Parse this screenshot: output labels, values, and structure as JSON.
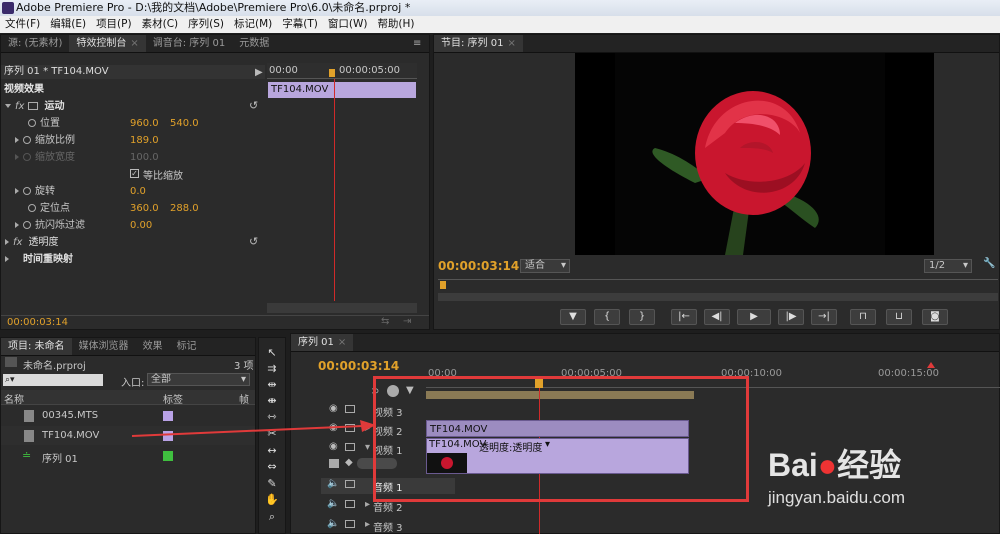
{
  "window": {
    "title": "Adobe Premiere Pro - D:\\我的文档\\Adobe\\Premiere Pro\\6.0\\未命名.prproj *"
  },
  "menu": [
    "文件(F)",
    "编辑(E)",
    "项目(P)",
    "素材(C)",
    "序列(S)",
    "标记(M)",
    "字幕(T)",
    "窗口(W)",
    "帮助(H)"
  ],
  "source_panel": {
    "tabs": [
      "源: (无素材)",
      "特效控制台",
      "调音台: 序列 01",
      "元数据"
    ],
    "header": "序列 01 * TF104.MOV",
    "mini_ruler": [
      "00:00",
      "00:00:05:00"
    ],
    "clip_label": "TF104.MOV",
    "section_video": "视频效果",
    "motion": "运动",
    "position": {
      "label": "位置",
      "x": "960.0",
      "y": "540.0"
    },
    "scale": {
      "label": "缩放比例",
      "value": "189.0"
    },
    "scale_width": {
      "label": "缩放宽度",
      "value": "100.0"
    },
    "uniform": "等比缩放",
    "rotation": {
      "label": "旋转",
      "value": "0.0"
    },
    "anchor": {
      "label": "定位点",
      "x": "360.0",
      "y": "288.0"
    },
    "antiflicker": {
      "label": "抗闪烁过滤",
      "value": "0.00"
    },
    "opacity": "透明度",
    "time_remap": "时间重映射",
    "timecode": "00:00:03:14"
  },
  "program": {
    "tab": "节目: 序列 01",
    "timecode": "00:00:03:14",
    "fit": "适合",
    "resolution": "1/2"
  },
  "project": {
    "tabs": [
      "项目: 未命名",
      "媒体浏览器",
      "效果",
      "标记"
    ],
    "filename": "未命名.prproj",
    "count": "3 项",
    "search_placeholder": "",
    "entry_label": "入口:",
    "entry_value": "全部",
    "col_name": "名称",
    "col_label": "标签",
    "col_frame": "帧",
    "items": [
      {
        "name": "00345.MTS",
        "color": "#b9a2e6"
      },
      {
        "name": "TF104.MOV",
        "color": "#b9a2e6"
      },
      {
        "name": "序列 01",
        "color": "#3fbf3f"
      }
    ]
  },
  "timeline": {
    "tab": "序列 01",
    "timecode": "00:00:03:14",
    "ruler": [
      "00:00",
      "00:00:05:00",
      "00:00:10:00",
      "00:00:15:00"
    ],
    "tracks": [
      "视频 3",
      "视频 2",
      "视频 1",
      "音频 1",
      "音频 2",
      "音频 3"
    ],
    "clip_v2": "TF104.MOV",
    "clip_v1": "TF104.MOV",
    "clip_v1_effect": "透明度:透明度"
  },
  "watermark": {
    "brand": "Bai",
    "brand2": "经验",
    "url": "jingyan.baidu.com"
  },
  "colors": {
    "accent": "#e1a12a",
    "clip": "#b8a6dd",
    "highlight": "#e03a3a"
  }
}
